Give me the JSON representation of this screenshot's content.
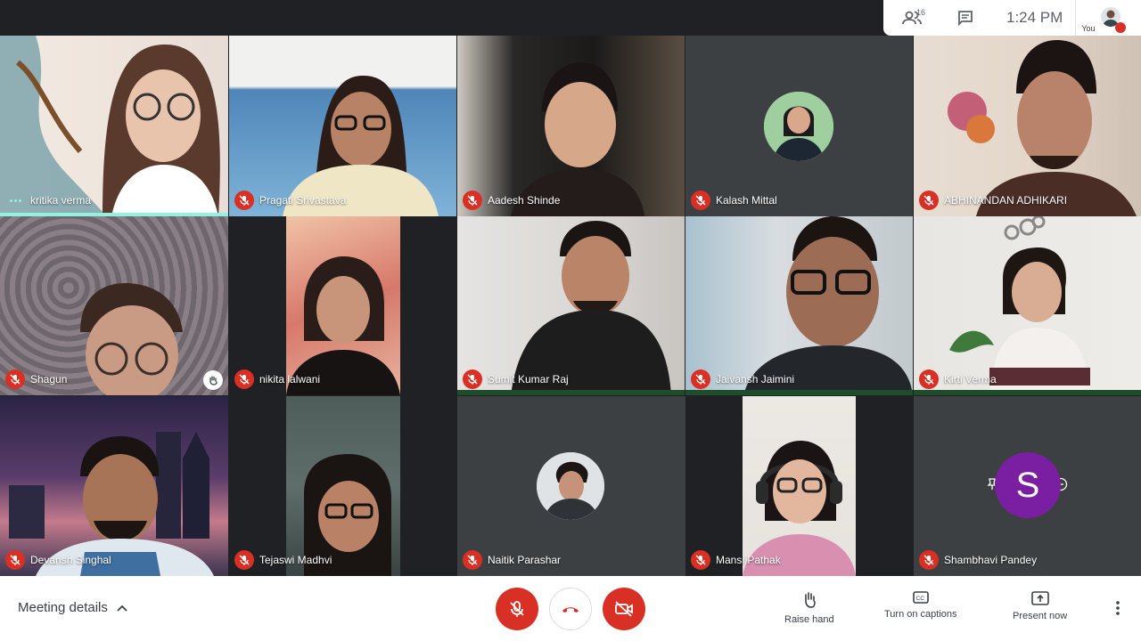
{
  "top": {
    "participants_count": "16",
    "time": "1:24 PM",
    "you_label": "You"
  },
  "tiles": [
    {
      "name": "kritika verma",
      "speaking": true
    },
    {
      "name": "Pragati Srivastava"
    },
    {
      "name": "Aadesh Shinde"
    },
    {
      "name": "Kalash Mittal"
    },
    {
      "name": "ABHINANDAN ADHIKARI"
    },
    {
      "name": "Shagun"
    },
    {
      "name": "nikita lalwani"
    },
    {
      "name": "Sumit Kumar Raj"
    },
    {
      "name": "Jaivansh Jaimini"
    },
    {
      "name": "Kirti Verma"
    },
    {
      "name": "Devansh Singhal"
    },
    {
      "name": "Tejaswi Madhvi"
    },
    {
      "name": "Naitik Parashar"
    },
    {
      "name": "Mansi Pathak"
    },
    {
      "name": "Shambhavi Pandey",
      "avatar_letter": "S"
    }
  ],
  "bottom": {
    "meeting_details": "Meeting details",
    "raise_hand": "Raise hand",
    "captions": "Turn on captions",
    "present": "Present now"
  },
  "colors": {
    "brand_red": "#d93025",
    "speaking_accent": "#8ff3dd",
    "avatar_purple": "#7b1fa2",
    "background": "#202124"
  }
}
